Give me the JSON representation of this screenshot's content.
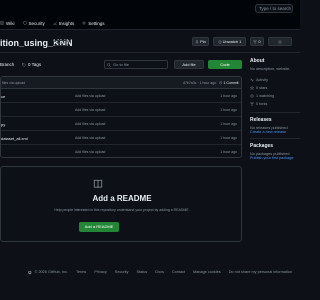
{
  "header": {
    "search_label": "Type / to search",
    "nav": [
      {
        "label": "Wiki",
        "icon": "book-icon"
      },
      {
        "label": "Security",
        "icon": "shield-icon"
      },
      {
        "label": "Insights",
        "icon": "graph-icon"
      },
      {
        "label": "Settings",
        "icon": "gear-icon"
      }
    ]
  },
  "repo": {
    "title": "ition_using_KNN",
    "visibility": "Public",
    "buttons": {
      "pin": "Pin",
      "unwatch": "Unwatch",
      "unwatch_count": "1",
      "fork": "0"
    }
  },
  "toolbar": {
    "branches": "Branch",
    "tags": "0 Tags",
    "goto_placeholder": "Go to file",
    "goto_shortcut": "t",
    "add_file": "Add file",
    "code": "Code"
  },
  "commit": {
    "message": "files via upload",
    "hash_time": "d7b7a3c · 1 hour ago",
    "count": "1 Commit"
  },
  "files": [
    {
      "name": "ce",
      "message": "Add files via upload",
      "date": "1 hour ago"
    },
    {
      "name": "",
      "message": "Add files via upload",
      "date": "1 hour ago"
    },
    {
      "name": "py",
      "message": "Add files via upload",
      "date": "1 hour ago"
    },
    {
      "name": "dataset_all.xml",
      "message": "Add files via upload",
      "date": "1 hour ago"
    },
    {
      "name": "",
      "message": "Add files via upload",
      "date": "1 hour ago"
    }
  ],
  "readme": {
    "title": "Add a README",
    "help": "Help people interested in this repository understand your project by adding a README.",
    "button": "Add a README"
  },
  "sidebar": {
    "about_title": "About",
    "about_text": "No description, website,",
    "stats": [
      {
        "label": "Activity",
        "icon": "pulse-icon"
      },
      {
        "label": "0 stars",
        "icon": "star-icon"
      },
      {
        "label": "1 watching",
        "icon": "eye-icon"
      },
      {
        "label": "0 forks",
        "icon": "fork-icon"
      }
    ],
    "releases_title": "Releases",
    "releases_text": "No releases published",
    "releases_link": "Create a new release",
    "packages_title": "Packages",
    "packages_text": "No packages published",
    "packages_link": "Publish your first package"
  },
  "footer": {
    "copyright": "© 2025 GitHub, Inc.",
    "links": [
      "Terms",
      "Privacy",
      "Security",
      "Status",
      "Docs",
      "Contact",
      "Manage cookies",
      "Do not share my personal information"
    ]
  },
  "colors": {
    "background": "#0d1117",
    "border": "#30363d",
    "green": "#238636",
    "link": "#4493f8",
    "muted": "#8b949e"
  }
}
